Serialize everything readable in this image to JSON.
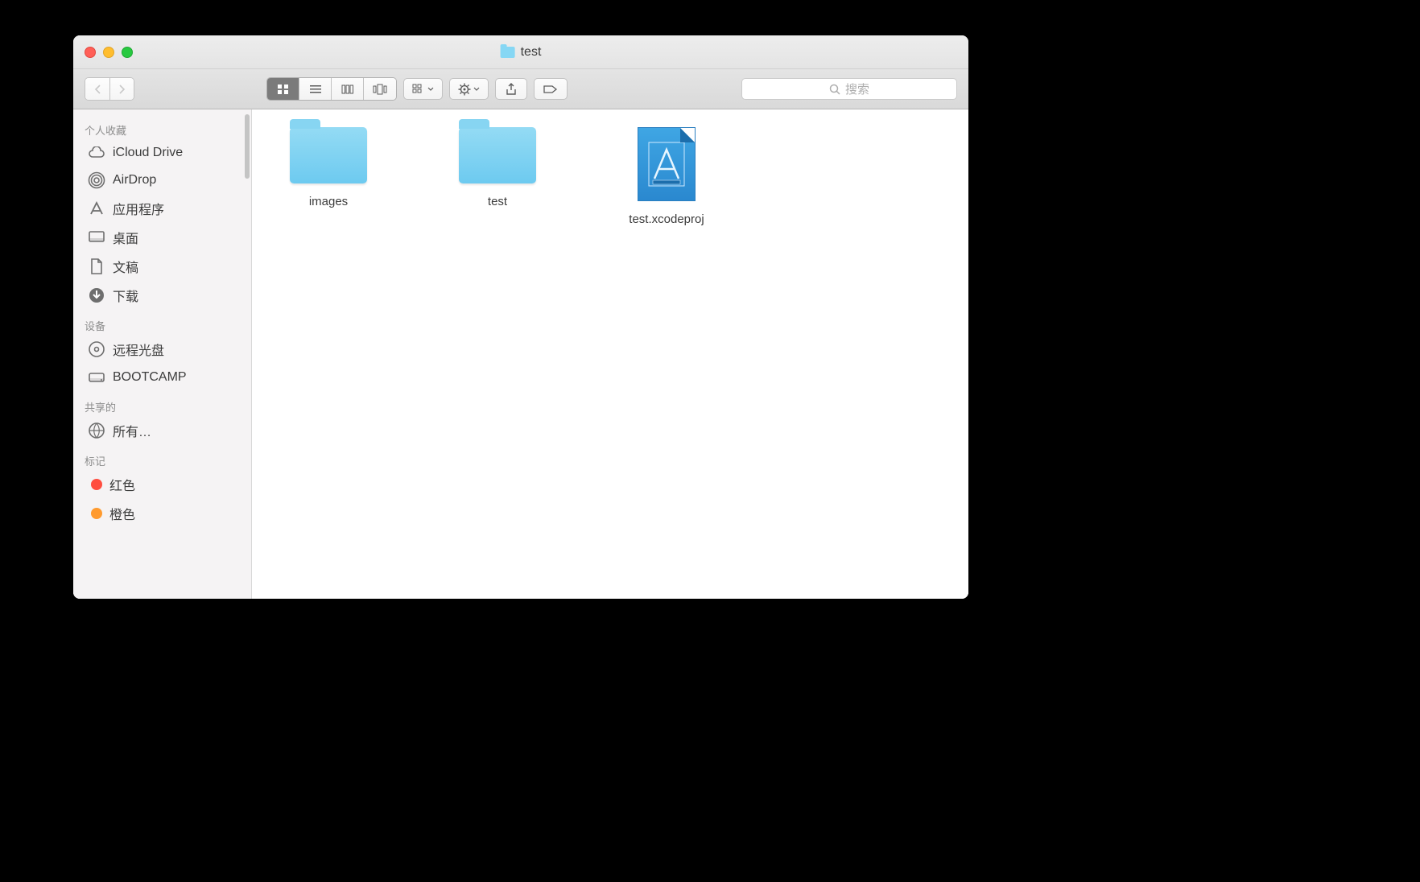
{
  "window": {
    "title": "test"
  },
  "toolbar": {
    "search_placeholder": "搜索"
  },
  "sidebar": {
    "sections": [
      {
        "header": "个人收藏",
        "items": [
          {
            "icon": "cloud",
            "label": "iCloud Drive"
          },
          {
            "icon": "airdrop",
            "label": "AirDrop"
          },
          {
            "icon": "apps",
            "label": "应用程序"
          },
          {
            "icon": "desktop",
            "label": "桌面"
          },
          {
            "icon": "documents",
            "label": "文稿"
          },
          {
            "icon": "downloads",
            "label": "下载"
          }
        ]
      },
      {
        "header": "设备",
        "items": [
          {
            "icon": "disc",
            "label": "远程光盘"
          },
          {
            "icon": "drive",
            "label": "BOOTCAMP"
          }
        ]
      },
      {
        "header": "共享的",
        "items": [
          {
            "icon": "network",
            "label": "所有…"
          }
        ]
      },
      {
        "header": "标记",
        "items": [
          {
            "icon": "tag-red",
            "label": "红色",
            "color": "#ff4d3f"
          },
          {
            "icon": "tag-orange",
            "label": "橙色",
            "color": "#ff9a2e"
          }
        ]
      }
    ]
  },
  "files": [
    {
      "type": "folder",
      "name": "images"
    },
    {
      "type": "folder",
      "name": "test"
    },
    {
      "type": "xcodeproj",
      "name": "test.xcodeproj"
    }
  ]
}
